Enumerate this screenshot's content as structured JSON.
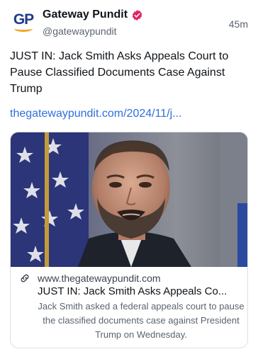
{
  "account": {
    "avatar_text": "GP",
    "display_name": "Gateway Pundit",
    "handle": "@gatewaypundit",
    "verified": true
  },
  "post": {
    "time": "45m",
    "text": "JUST IN: Jack Smith Asks Appeals Court to Pause Classified Documents Case Against Trump",
    "link_text": "thegatewaypundit.com/2024/11/j..."
  },
  "card": {
    "domain": "www.thegatewaypundit.com",
    "title": "JUST IN: Jack Smith Asks Appeals Co...",
    "description": "Jack Smith asked a federal appeals court to pause the classified documents case against President Trump on Wednesday."
  },
  "colors": {
    "link": "#2f6fdd",
    "verified_badge": "#e0245e",
    "avatar_brand": "#1f3a8a",
    "avatar_accent": "#f5a623"
  },
  "icons": {
    "verified": "verified-badge-icon",
    "link": "link-icon"
  }
}
